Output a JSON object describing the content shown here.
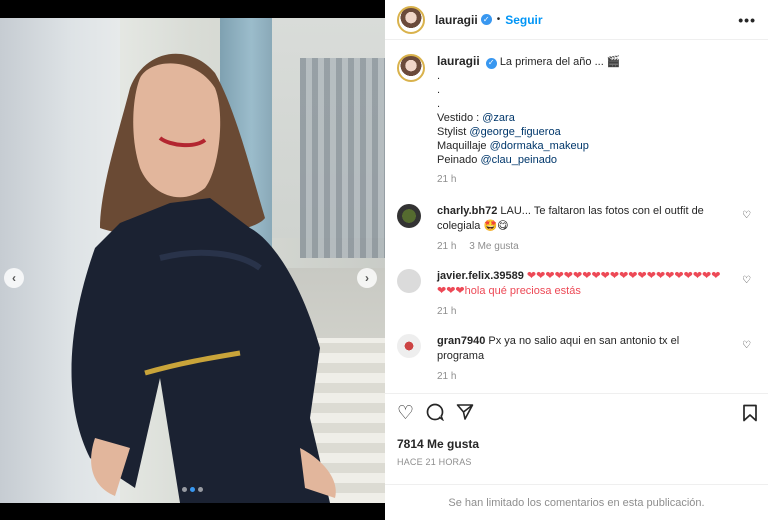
{
  "post": {
    "username": "lauragii",
    "follow_label": "Seguir",
    "more_label": "•••",
    "separator": "•"
  },
  "caption": {
    "text": "La primera del año ...",
    "dots": [
      ".",
      ".",
      "."
    ],
    "credits": [
      {
        "label": "Vestido : ",
        "handle": "@zara"
      },
      {
        "label": "Stylist ",
        "handle": "@george_figueroa"
      },
      {
        "label": "Maquillaje ",
        "handle": "@dormaka_makeup"
      },
      {
        "label": "Peinado ",
        "handle": "@clau_peinado"
      }
    ],
    "time": "21 h"
  },
  "comments": [
    {
      "user": "charly.bh72",
      "text": "LAU... Te faltaron las fotos con el outfit de colegiala 🤩😋",
      "time": "21 h",
      "likes": "3 Me gusta"
    },
    {
      "user": "javier.felix.39589",
      "text": "❤❤❤❤❤❤❤❤❤❤❤❤❤❤❤❤❤❤❤❤❤❤❤❤hola qué preciosa estás",
      "time": "21 h",
      "likes": ""
    },
    {
      "user": "gran7940",
      "text": "Px ya no salio aqui en san antonio tx el programa",
      "time": "21 h",
      "likes": ""
    }
  ],
  "stats": {
    "likes": "7814 Me gusta",
    "ago": "HACE 21 HORAS"
  },
  "footer": {
    "limited": "Se han limitado los comentarios en esta publicación."
  },
  "carousel": {
    "slides": 3,
    "active": 1
  }
}
